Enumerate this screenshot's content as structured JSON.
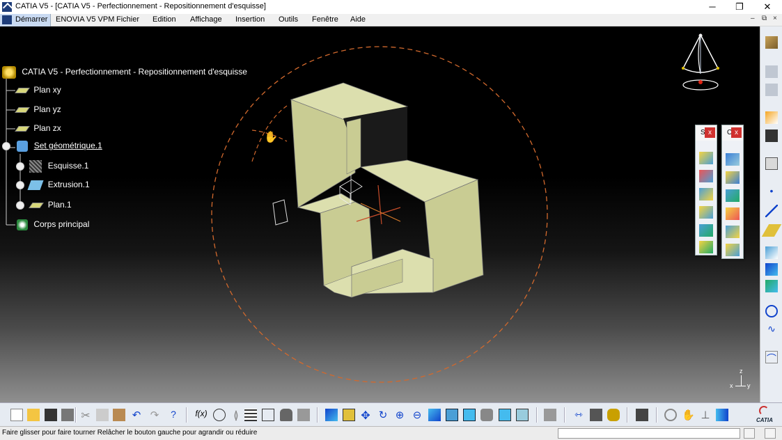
{
  "window": {
    "title": "CATIA V5 - [CATIA V5 - Perfectionnement - Repositionnement d'esquisse]",
    "minimize": "─",
    "maximize": "❐",
    "close": "✕"
  },
  "menu": {
    "start": "Démarrer",
    "items": [
      "ENOVIA V5 VPM",
      "Fichier",
      "Edition",
      "Affichage",
      "Insertion",
      "Outils",
      "Fenêtre",
      "Aide"
    ],
    "mdi_minimize": "–",
    "mdi_restore": "⧉",
    "mdi_close": "×"
  },
  "tree": {
    "root": "CATIA V5 - Perfectionnement - Repositionnement d'esquisse",
    "items": [
      {
        "label": "Plan xy",
        "icon": "plane-icon"
      },
      {
        "label": "Plan yz",
        "icon": "plane-icon"
      },
      {
        "label": "Plan zx",
        "icon": "plane-icon"
      },
      {
        "label": "Set géométrique.1",
        "icon": "geometric-set-icon"
      },
      {
        "label": "Esquisse.1",
        "icon": "sketch-icon"
      },
      {
        "label": "Extrusion.1",
        "icon": "extrude-icon"
      },
      {
        "label": "Plan.1",
        "icon": "plane-icon"
      },
      {
        "label": "Corps principal",
        "icon": "part-body-icon"
      }
    ]
  },
  "floating_toolbars": [
    {
      "title": "S",
      "close": "x"
    },
    {
      "title": "C",
      "close": "x"
    }
  ],
  "axis_labels": {
    "z": "z",
    "x": "x",
    "y": "y"
  },
  "status": {
    "message": "Faire glisser pour faire tourner  Relâcher le bouton gauche pour agrandir ou réduire"
  },
  "brand": "CATIA",
  "colors": {
    "part_face": "#dcdfae",
    "part_side": "#c8cb93",
    "rotation_circle": "#d2692d",
    "menu_bg": "#f0f0f0",
    "toolbar_bg": "#e6ebf2"
  }
}
